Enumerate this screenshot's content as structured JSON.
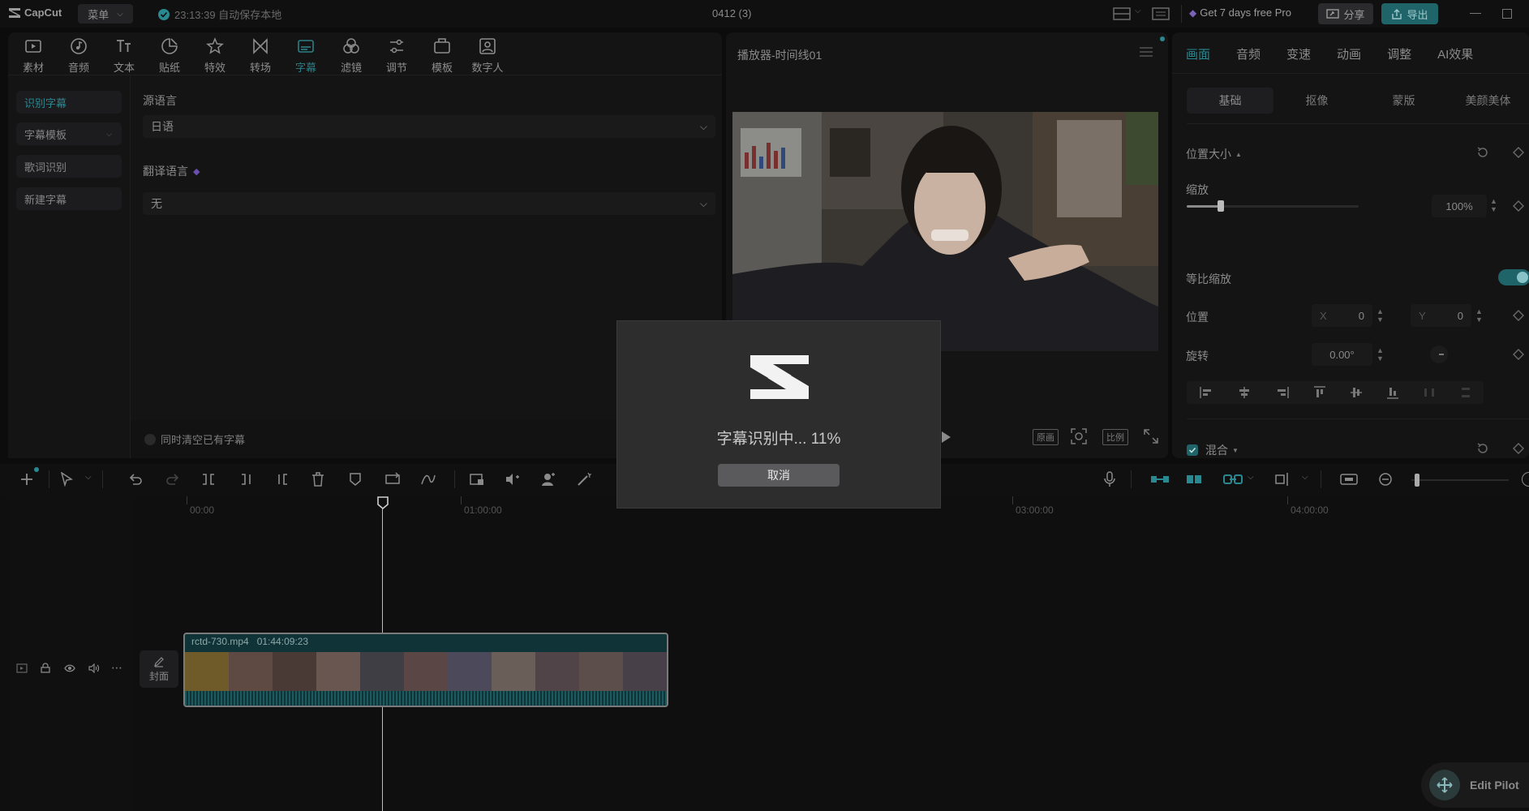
{
  "titlebar": {
    "brand": "CapCut",
    "menu_label": "菜单",
    "autosave": "23:13:39 自动保存本地",
    "project_title": "0412 (3)",
    "pro_offer": "Get 7 days free Pro",
    "share_label": "分享",
    "export_label": "导出"
  },
  "toolbar": {
    "items": [
      {
        "label": "素材",
        "icon": "media-icon"
      },
      {
        "label": "音频",
        "icon": "audio-icon"
      },
      {
        "label": "文本",
        "icon": "text-icon"
      },
      {
        "label": "贴纸",
        "icon": "sticker-icon"
      },
      {
        "label": "特效",
        "icon": "effects-icon"
      },
      {
        "label": "转场",
        "icon": "transition-icon"
      },
      {
        "label": "字幕",
        "icon": "caption-icon"
      },
      {
        "label": "滤镜",
        "icon": "filter-icon"
      },
      {
        "label": "调节",
        "icon": "adjust-icon"
      },
      {
        "label": "模板",
        "icon": "template-icon"
      },
      {
        "label": "数字人",
        "icon": "avatar-icon"
      }
    ],
    "active": "字幕"
  },
  "captions_sidebar": {
    "items": [
      "识别字幕",
      "字幕模板",
      "歌词识别",
      "新建字幕"
    ],
    "active": "识别字幕"
  },
  "captions_form": {
    "source_language_label": "源语言",
    "source_language_value": "日语",
    "translate_language_label": "翻译语言",
    "translate_language_value": "无",
    "clear_existing_label": "同时清空已有字幕"
  },
  "player": {
    "title": "播放器-时间线01",
    "original_label": "原画",
    "ratio_label": "比例"
  },
  "inspector": {
    "tabs": [
      "画面",
      "音频",
      "变速",
      "动画",
      "调整",
      "AI效果"
    ],
    "active_tab": "画面",
    "subtabs": [
      "基础",
      "抠像",
      "蒙版",
      "美颜美体"
    ],
    "active_subtab": "基础",
    "section_position_size": "位置大小",
    "scale_label": "缩放",
    "scale_value": "100%",
    "scale_fraction": 0.2,
    "uniform_scale_label": "等比缩放",
    "position_label": "位置",
    "x_label": "X",
    "x_value": "0",
    "y_label": "Y",
    "y_value": "0",
    "rotation_label": "旋转",
    "rotation_value": "0.00°",
    "blend_label": "混合"
  },
  "timeline": {
    "ruler_labels": [
      "00:00",
      "01:00:00",
      "03:00:00",
      "04:00:00"
    ],
    "clip_name": "rctd-730.mp4",
    "clip_duration": "01:44:09:23",
    "cover_label": "封面"
  },
  "modal": {
    "status_text": "字幕识别中... 11%",
    "progress": 0.11,
    "cancel_label": "取消"
  },
  "edit_pilot": {
    "label": "Edit Pilot"
  },
  "colors": {
    "accent": "#2a8890",
    "background": "#0c0c0d",
    "panel": "#141415",
    "modal": "#2d2d2e"
  }
}
